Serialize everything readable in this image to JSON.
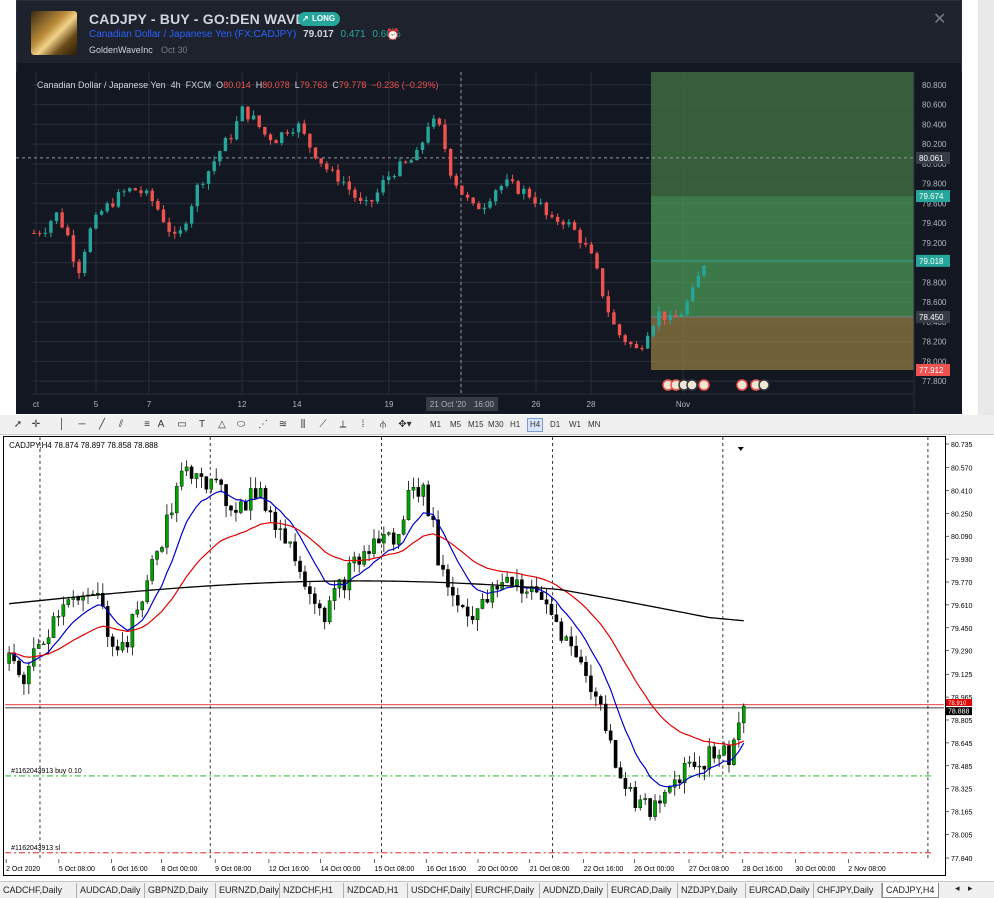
{
  "tv": {
    "title": "CADJPY - BUY - GO:DEN WAVE INC",
    "long_badge": "LONG",
    "symbol_desc": "Canadian Dollar / Japanese Yen",
    "symbol_code": "(FX:CADJPY)",
    "price": "79.017",
    "change": "0.471",
    "change_pct": "0.60%",
    "author": "GoldenWaveInc",
    "date": "Oct 30",
    "legend": {
      "name": "Canadian Dollar / Japanese Yen",
      "interval": "4h",
      "exchange": "FXCM",
      "o_label": "O",
      "o": "80.014",
      "h_label": "H",
      "h": "80.078",
      "l_label": "L",
      "l": "79.763",
      "c_label": "C",
      "c": "79.778",
      "chg": "−0.236 (−0.29%)"
    },
    "y_ticks": [
      "80.800",
      "80.600",
      "80.400",
      "80.200",
      "80.000",
      "79.800",
      "79.600",
      "79.400",
      "79.200",
      "79.000",
      "78.800",
      "78.600",
      "78.400",
      "78.200",
      "78.000",
      "77.800"
    ],
    "price_tags": [
      {
        "value": "80.061",
        "color": "#363a45"
      },
      {
        "value": "79.674",
        "color": "#26a69a"
      },
      {
        "value": "79.018",
        "color": "#26a69a"
      },
      {
        "value": "78.450",
        "color": "#363a45"
      },
      {
        "value": "77.912",
        "color": "#ef5350"
      }
    ],
    "x_ticks": [
      "ct",
      "5",
      "7",
      "12",
      "14",
      "19",
      "21 Oct '20",
      "16:00",
      "26",
      "28",
      "Nov"
    ],
    "colors": {
      "up": "#26a69a",
      "down": "#ef5350",
      "profit": "#4caf50",
      "loss": "#c8a24a"
    }
  },
  "mt4": {
    "header": "CADJPY,H4  78.874 78.897 78.858 78.888",
    "timeframes": [
      "M1",
      "M5",
      "M15",
      "M30",
      "H1",
      "H4",
      "D1",
      "W1",
      "MN"
    ],
    "active_timeframe": "H4",
    "y_ticks": [
      "80.735",
      "80.570",
      "80.410",
      "80.250",
      "80.090",
      "79.930",
      "79.770",
      "79.610",
      "79.450",
      "79.290",
      "79.125",
      "78.965",
      "78.805",
      "78.645",
      "78.485",
      "78.325",
      "78.165",
      "78.005",
      "77.840"
    ],
    "price_tag_1": "78.910",
    "price_tag_2": "78.888",
    "x_ticks": [
      "2 Oct 2020",
      "5 Oct 08:00",
      "6 Oct 16:00",
      "8 Oct 00:00",
      "9 Oct 08:00",
      "12 Oct 16:00",
      "14 Oct 00:00",
      "15 Oct 08:00",
      "16 Oct 16:00",
      "20 Oct 00:00",
      "21 Oct 08:00",
      "22 Oct 16:00",
      "26 Oct 00:00",
      "27 Oct 08:00",
      "28 Oct 16:00",
      "30 Oct 00:00",
      "2 Nov 08:00"
    ],
    "order_buy": "#1162043913 buy 0.10",
    "order_sl": "#1162043913 sl",
    "tabs": [
      "CADCHF,Daily",
      "AUDCAD,Daily",
      "GBPNZD,Daily",
      "EURNZD,Daily",
      "NZDCHF,H1",
      "NZDCAD,H1",
      "USDCHF,Daily",
      "EURCHF,Daily",
      "AUDNZD,Daily",
      "EURCAD,Daily",
      "NZDJPY,Daily",
      "EURCAD,Daily",
      "CHFJPY,Daily",
      "CADJPY,H4"
    ],
    "active_tab": "CADJPY,H4",
    "colors": {
      "ma_fast": "#0000cc",
      "ma_mid": "#e00000",
      "ma_slow": "#000000",
      "up": "#00a000",
      "down": "#000000"
    }
  },
  "chart_data": [
    {
      "type": "candlestick",
      "title": "Canadian Dollar / Japanese Yen 4h FXCM",
      "x": [
        "ct",
        "5",
        "7",
        "12",
        "14",
        "19",
        "21 Oct '20",
        "26",
        "28",
        "Nov"
      ],
      "ylim": [
        77.8,
        80.8
      ],
      "close_path": [
        79.3,
        79.35,
        79.5,
        79.3,
        78.9,
        79.3,
        79.5,
        79.6,
        79.7,
        79.75,
        79.7,
        79.6,
        79.4,
        79.2,
        79.5,
        79.8,
        79.95,
        80.15,
        80.3,
        80.55,
        80.45,
        80.3,
        80.25,
        80.35,
        80.4,
        80.2,
        80.05,
        79.9,
        79.85,
        79.7,
        79.55,
        79.65,
        79.85,
        79.95,
        80.0,
        80.1,
        80.45,
        80.35,
        79.9,
        79.7,
        79.55,
        79.6,
        79.75,
        79.8,
        79.75,
        79.7,
        79.6,
        79.4,
        79.45,
        79.35,
        79.2,
        79.0,
        78.6,
        78.3,
        78.2,
        78.1,
        78.35,
        78.5,
        78.4,
        78.5,
        78.7,
        79.0
      ]
    },
    {
      "type": "candlestick",
      "title": "CADJPY,H4",
      "x": [
        "2 Oct 2020",
        "5 Oct 08:00",
        "6 Oct 16:00",
        "8 Oct 00:00",
        "9 Oct 08:00",
        "12 Oct 16:00",
        "14 Oct 00:00",
        "15 Oct 08:00",
        "16 Oct 16:00",
        "20 Oct 00:00",
        "21 Oct 08:00",
        "22 Oct 16:00",
        "26 Oct 00:00",
        "27 Oct 08:00",
        "28 Oct 16:00",
        "30 Oct 00:00",
        "2 Nov 08:00"
      ],
      "ylim": [
        77.84,
        80.735
      ],
      "close_path": [
        79.2,
        79.1,
        79.3,
        79.5,
        79.7,
        79.6,
        79.7,
        79.4,
        79.3,
        79.6,
        79.9,
        80.2,
        80.5,
        80.6,
        80.45,
        80.35,
        80.3,
        80.4,
        80.3,
        80.1,
        79.95,
        79.7,
        79.55,
        79.75,
        79.9,
        80.0,
        80.1,
        80.05,
        80.5,
        80.35,
        79.85,
        79.65,
        79.55,
        79.6,
        79.75,
        79.8,
        79.7,
        79.65,
        79.5,
        79.3,
        79.15,
        78.9,
        78.55,
        78.3,
        78.2,
        78.15,
        78.35,
        78.5,
        78.5,
        78.6,
        78.55,
        78.89
      ]
    }
  ]
}
